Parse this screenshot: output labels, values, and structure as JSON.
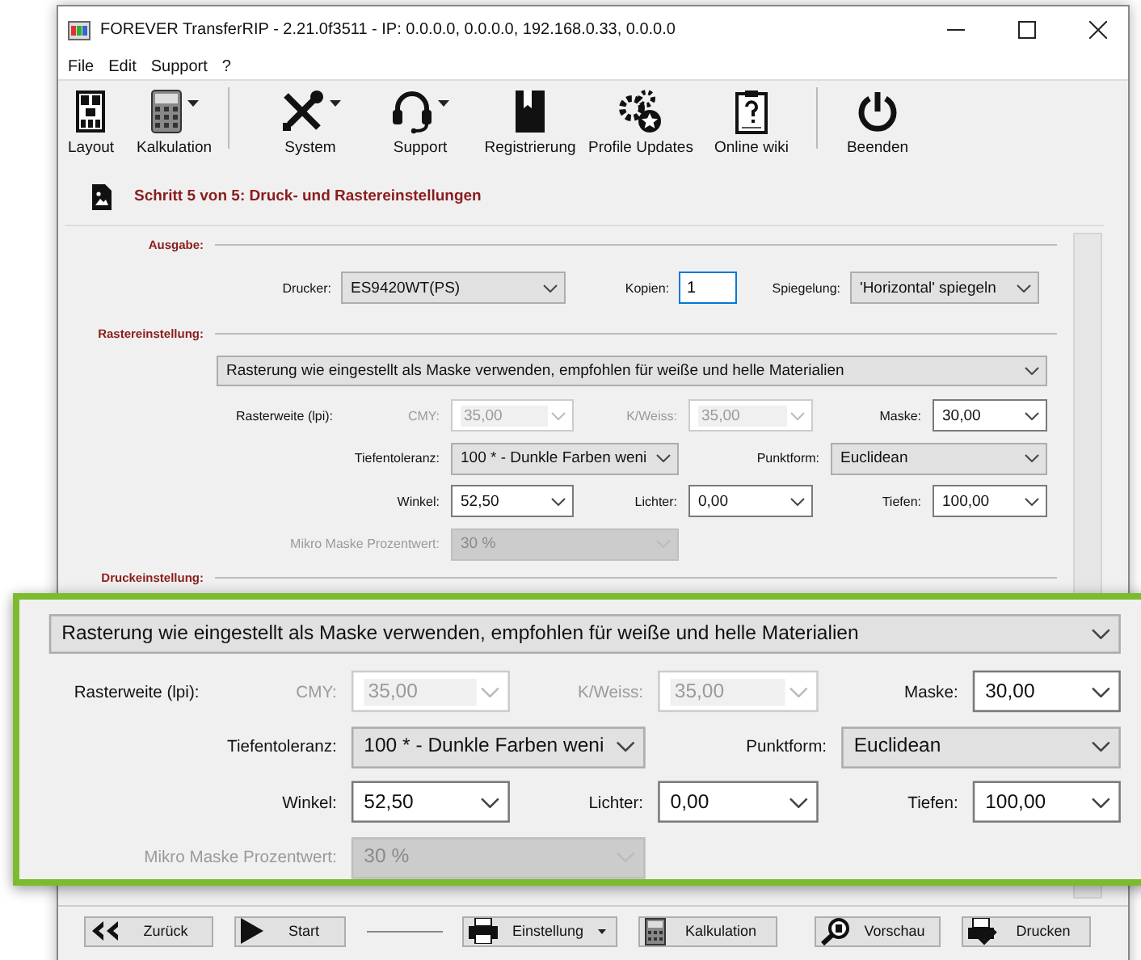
{
  "window": {
    "title": "FOREVER TransferRIP - 2.21.0f3511 - IP: 0.0.0.0, 0.0.0.0, 192.168.0.33, 0.0.0.0"
  },
  "menu": [
    "File",
    "Edit",
    "Support",
    "?"
  ],
  "toolbar": [
    [
      {
        "label": "Layout",
        "kind": "layout",
        "dropdown": false
      },
      {
        "label": "Kalkulation",
        "kind": "calculator",
        "dropdown": true
      }
    ],
    [
      {
        "label": "System",
        "kind": "tools",
        "dropdown": true
      },
      {
        "label": "Support",
        "kind": "headset",
        "dropdown": true
      },
      {
        "label": "Registrierung",
        "kind": "bookmark",
        "dropdown": false
      },
      {
        "label": "Profile Updates",
        "kind": "gears",
        "dropdown": false
      },
      {
        "label": "Online wiki",
        "kind": "clipboard",
        "dropdown": false
      }
    ],
    [
      {
        "label": "Beenden",
        "kind": "power",
        "dropdown": false
      }
    ]
  ],
  "step": {
    "title": "Schritt 5 von 5: Druck- und Rastereinstellungen"
  },
  "output_section": {
    "heading": "Ausgabe:",
    "printer_label": "Drucker:",
    "printer": "ES9420WT(PS)",
    "copies_label": "Kopien:",
    "copies": "1",
    "copies_focused": true,
    "mirror_label": "Spiegelung:",
    "mirror": "'Horizontal' spiegeln"
  },
  "raster_section": {
    "heading": "Rastereinstellung:"
  },
  "raster_settings": {
    "mode": "Rasterung wie eingestellt als Maske verwenden, empfohlen für weiße und helle Materialien",
    "rows": [
      {
        "title": "Rasterweite (lpi):",
        "fields": [
          {
            "label": "CMY:",
            "value": "35,00",
            "kind": "combo",
            "disabled": true
          },
          {
            "label": "K/Weiss:",
            "value": "35,00",
            "kind": "combo",
            "disabled": true
          },
          {
            "label": "Maske:",
            "value": "30,00",
            "kind": "combo",
            "disabled": false
          }
        ]
      },
      {
        "fields": [
          {
            "label": "Tiefentoleranz:",
            "value": "100 * - Dunkle Farben weni",
            "kind": "dropdown",
            "disabled": false
          },
          {
            "label": "Punktform:",
            "value": "Euclidean",
            "kind": "dropdown",
            "disabled": false
          }
        ]
      },
      {
        "fields": [
          {
            "label": "Winkel:",
            "value": "52,50",
            "kind": "combo",
            "disabled": false
          },
          {
            "label": "Lichter:",
            "value": "0,00",
            "kind": "combo",
            "disabled": false
          },
          {
            "label": "Tiefen:",
            "value": "100,00",
            "kind": "combo",
            "disabled": false
          }
        ]
      },
      {
        "fields": [
          {
            "label": "Mikro Maske Prozentwert:",
            "value": "30 %",
            "kind": "dropdown",
            "disabled": true
          }
        ]
      }
    ]
  },
  "print_section": {
    "heading": "Druckeinstellung:"
  },
  "zoom_callout": {
    "mode": "Rasterung wie eingestellt als Maske verwenden, empfohlen für weiße und helle Materialien",
    "rows": [
      {
        "title": "Rasterweite (lpi):",
        "fields": [
          {
            "label": "CMY:",
            "value": "35,00",
            "kind": "combo",
            "disabled": true
          },
          {
            "label": "K/Weiss:",
            "value": "35,00",
            "kind": "combo",
            "disabled": true
          },
          {
            "label": "Maske:",
            "value": "30,00",
            "kind": "combo",
            "disabled": false
          }
        ]
      },
      {
        "fields": [
          {
            "label": "Tiefentoleranz:",
            "value": "100 * - Dunkle Farben weni",
            "kind": "dropdown",
            "disabled": false
          },
          {
            "label": "Punktform:",
            "value": "Euclidean",
            "kind": "dropdown",
            "disabled": false
          }
        ]
      },
      {
        "fields": [
          {
            "label": "Winkel:",
            "value": "52,50",
            "kind": "combo",
            "disabled": false
          },
          {
            "label": "Lichter:",
            "value": "0,00",
            "kind": "combo",
            "disabled": false
          },
          {
            "label": "Tiefen:",
            "value": "100,00",
            "kind": "combo",
            "disabled": false
          }
        ]
      },
      {
        "fields": [
          {
            "label": "Mikro Maske Prozentwert:",
            "value": "30 %",
            "kind": "dropdown",
            "disabled": true
          }
        ]
      }
    ]
  },
  "bottom_buttons": [
    {
      "label": "Zurück",
      "kind": "back",
      "dropdown": false
    },
    {
      "label": "Start",
      "kind": "play",
      "dropdown": false
    },
    {
      "label": "Einstellung",
      "kind": "printer",
      "dropdown": true
    },
    {
      "label": "Kalkulation",
      "kind": "calculator",
      "dropdown": false
    },
    {
      "label": "Vorschau",
      "kind": "preview",
      "dropdown": false
    },
    {
      "label": "Drucken",
      "kind": "print",
      "dropdown": false
    }
  ]
}
